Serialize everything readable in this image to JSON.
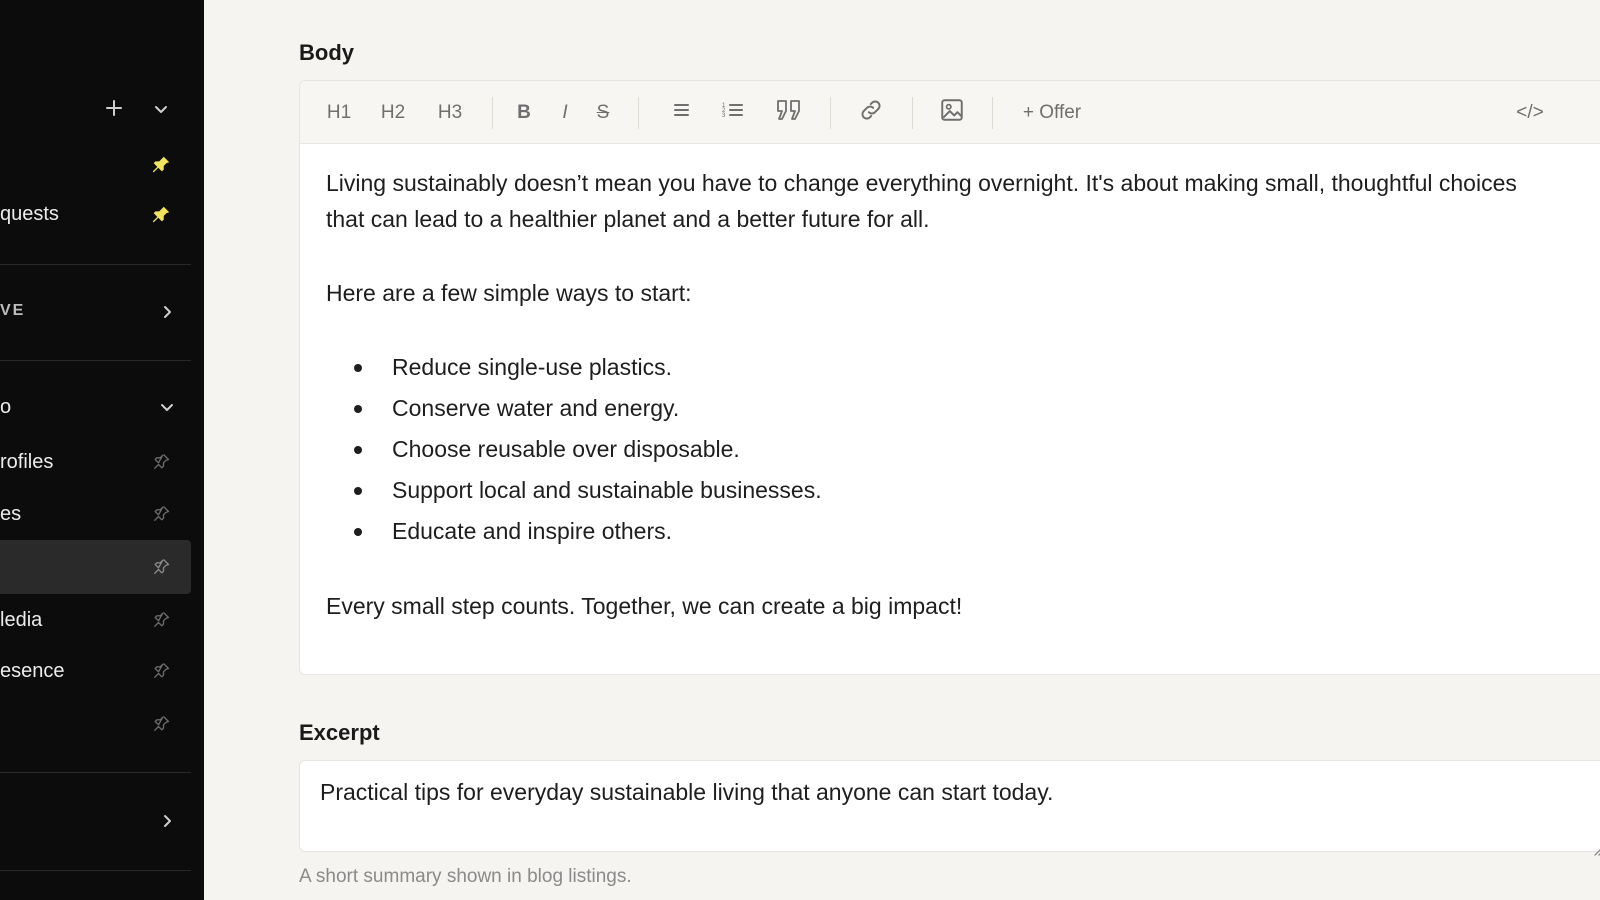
{
  "sidebar": {
    "items": [
      {
        "label": "quests",
        "pinned": true
      },
      {
        "label": "VE"
      },
      {
        "label": "o"
      },
      {
        "label": "rofiles",
        "pinned": false
      },
      {
        "label": "es",
        "pinned": false
      },
      {
        "label": "",
        "pinned": false,
        "active": true
      },
      {
        "label": "ledia",
        "pinned": false
      },
      {
        "label": "esence",
        "pinned": false
      },
      {
        "label": "",
        "pinned": false
      },
      {
        "label": ""
      }
    ],
    "accent_color": "#f2e35c"
  },
  "body_field": {
    "label": "Body",
    "toolbar": {
      "h1": "H1",
      "h2": "H2",
      "h3": "H3",
      "bold": "B",
      "italic": "I",
      "strike": "S",
      "offer": "+ Offer",
      "code": "</>"
    },
    "content": {
      "intro": "Living sustainably doesn’t mean you have to change everything overnight. It's about making small, thoughtful choices that can lead to a healthier planet and a better future for all.",
      "lead": "Here are a few simple ways to start:",
      "bullets": [
        "Reduce single-use plastics.",
        "Conserve water and energy.",
        "Choose reusable over disposable.",
        "Support local and sustainable businesses.",
        "Educate and inspire others."
      ],
      "closing": "Every small step counts. Together, we can create a big impact!"
    }
  },
  "excerpt_field": {
    "label": "Excerpt",
    "value": "Practical tips for everyday sustainable living that anyone can start today.",
    "help": "A short summary shown in blog listings."
  }
}
